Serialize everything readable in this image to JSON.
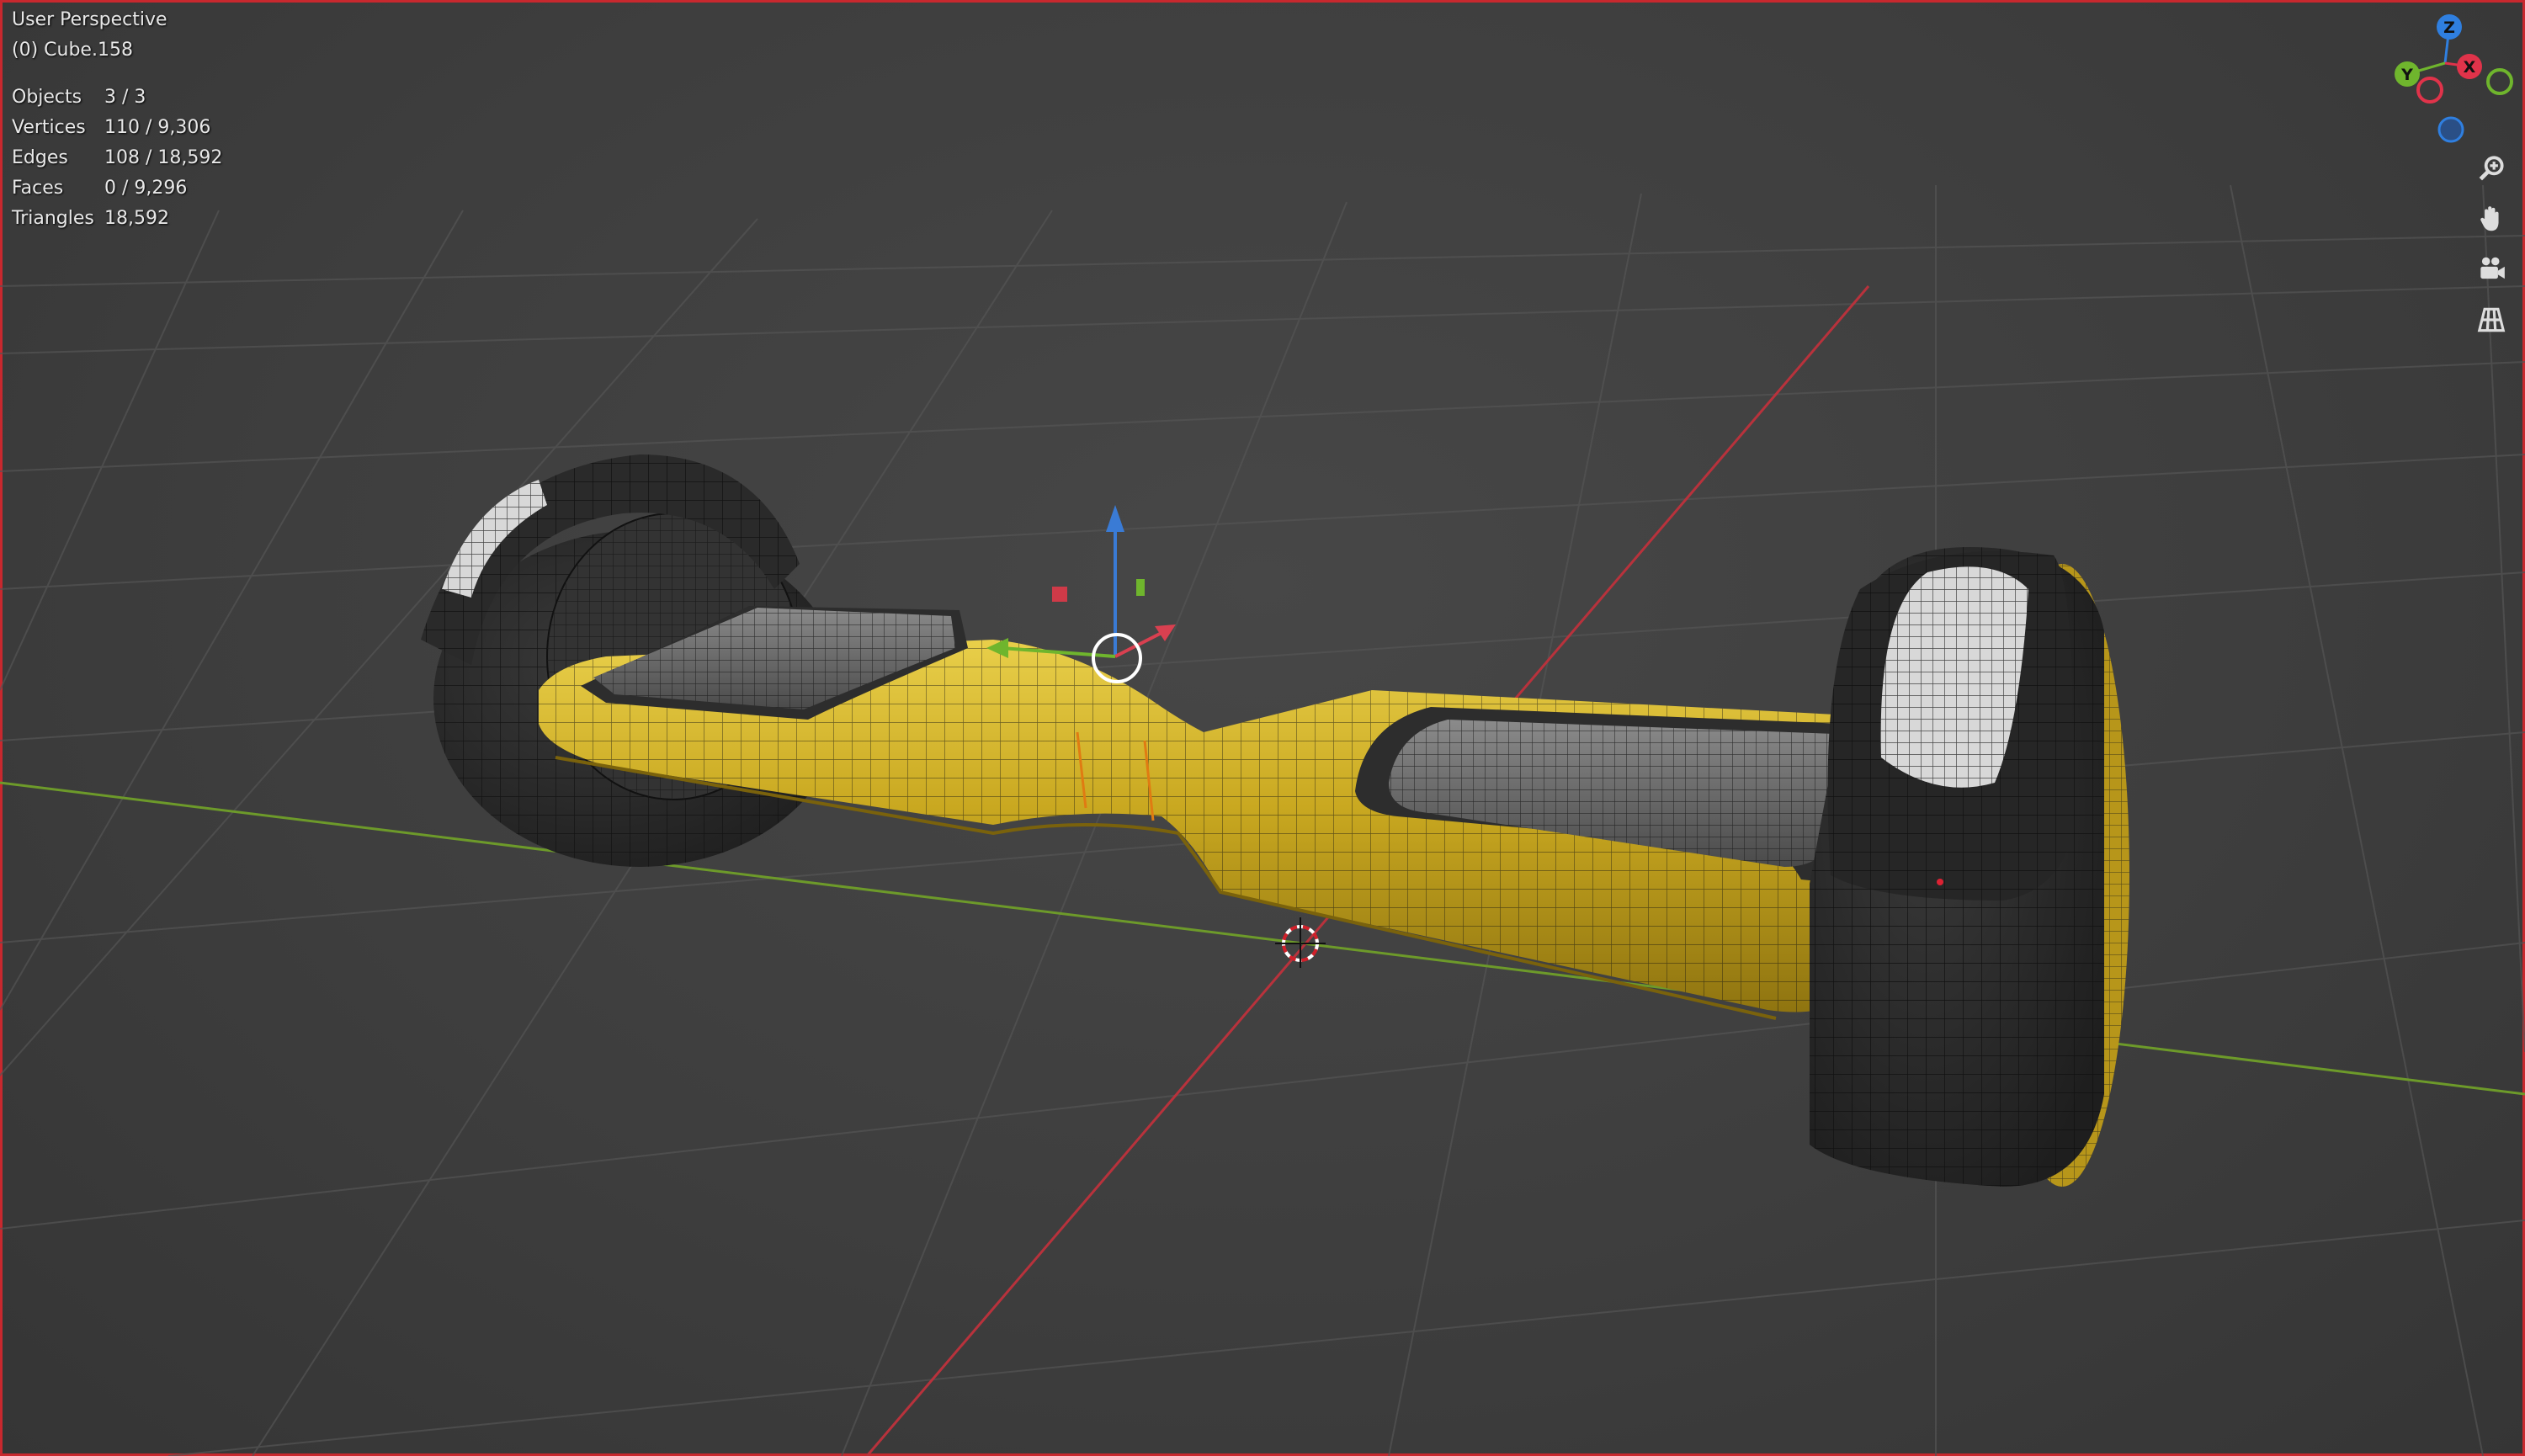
{
  "viewport": {
    "view_name": "User Perspective",
    "active_object": "(0) Cube.158"
  },
  "stats": [
    {
      "label": "Objects",
      "value": "3 / 3"
    },
    {
      "label": "Vertices",
      "value": "110 / 9,306"
    },
    {
      "label": "Edges",
      "value": "108 / 18,592"
    },
    {
      "label": "Faces",
      "value": "0 / 9,296"
    },
    {
      "label": "Triangles",
      "value": "18,592"
    }
  ],
  "navigation_gizmo": {
    "axes": [
      {
        "label": "Z",
        "color": "#2f7fe0"
      },
      {
        "label": "Y",
        "color": "#6fb52d"
      },
      {
        "label": "X",
        "color": "#e0334a"
      }
    ]
  },
  "nav_buttons": [
    {
      "icon": "zoom-icon"
    },
    {
      "icon": "hand-pan-icon"
    },
    {
      "icon": "camera-icon"
    },
    {
      "icon": "perspective-grid-icon"
    }
  ],
  "colors": {
    "body_yellow": "#c9a820",
    "tire_dark": "#2b2b2b",
    "axis_x": "#b8323c",
    "axis_y": "#6d9a2a",
    "frame_border": "#c8282e"
  }
}
